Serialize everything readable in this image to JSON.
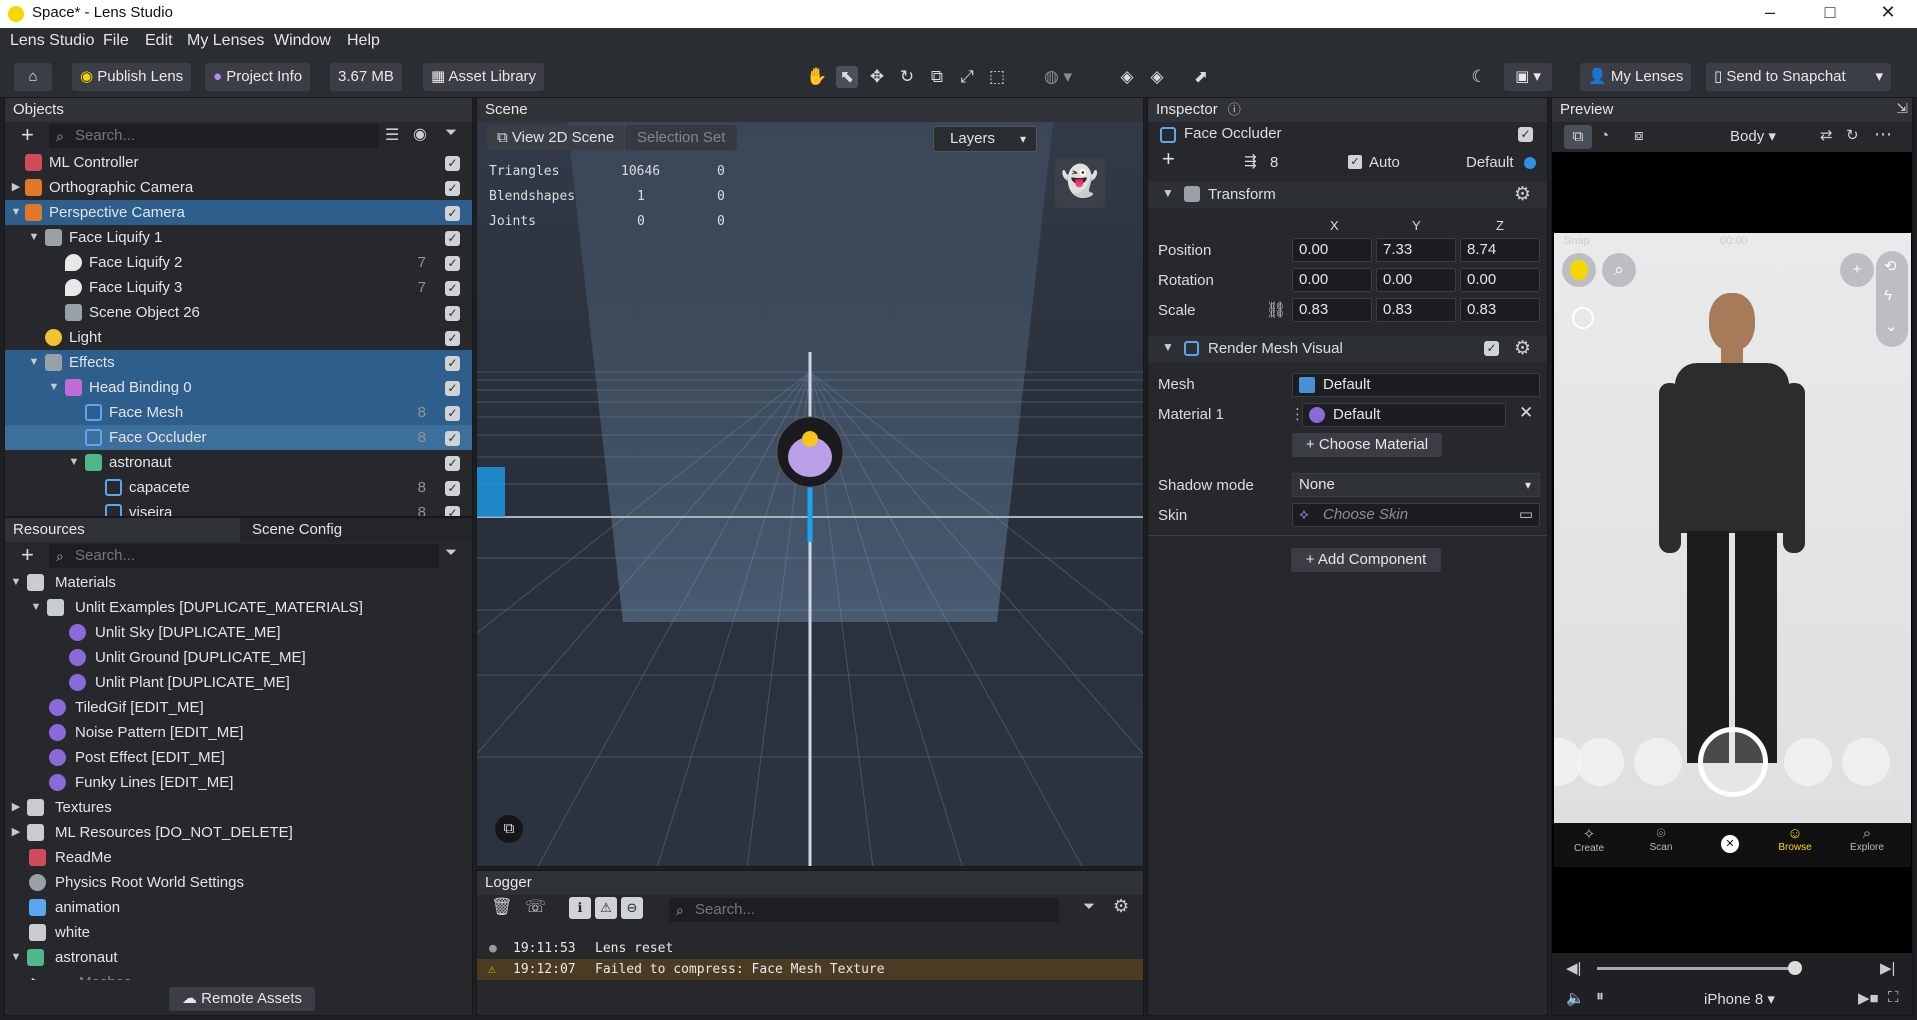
{
  "window": {
    "title": "Space* - Lens Studio",
    "minimize": "–",
    "maximize": "□",
    "close": "✕"
  },
  "menu": [
    "Lens Studio",
    "File",
    "Edit",
    "My Lenses",
    "Window",
    "Help"
  ],
  "toolbar": {
    "publish": "Publish Lens",
    "project_info": "Project Info",
    "size": "3.67 MB",
    "asset_library": "Asset Library",
    "my_lenses": "My Lenses",
    "send_to_snapchat": "Send to Snapchat"
  },
  "objects": {
    "title": "Objects",
    "search_placeholder": "Search...",
    "items": [
      {
        "label": "ML Controller",
        "num": "",
        "sel": false
      },
      {
        "label": "Orthographic Camera",
        "num": "",
        "sel": false
      },
      {
        "label": "Perspective Camera",
        "num": "",
        "sel": true
      },
      {
        "label": "Face Liquify 1",
        "num": "",
        "sel": false
      },
      {
        "label": "Face Liquify 2",
        "num": "7",
        "sel": false
      },
      {
        "label": "Face Liquify 3",
        "num": "7",
        "sel": false
      },
      {
        "label": "Scene Object 26",
        "num": "",
        "sel": false
      },
      {
        "label": "Light",
        "num": "",
        "sel": false
      },
      {
        "label": "Effects",
        "num": "",
        "sel": true
      },
      {
        "label": "Head Binding 0",
        "num": "",
        "sel": true
      },
      {
        "label": "Face Mesh",
        "num": "8",
        "sel": true
      },
      {
        "label": "Face Occluder",
        "num": "8",
        "sel": true
      },
      {
        "label": "astronaut",
        "num": "",
        "sel": false
      },
      {
        "label": "capacete",
        "num": "8",
        "sel": false
      },
      {
        "label": "viseira",
        "num": "8",
        "sel": false
      }
    ]
  },
  "resources": {
    "title": "Resources",
    "tab2": "Scene Config",
    "search_placeholder": "Search...",
    "items": [
      "Materials",
      "Unlit Examples [DUPLICATE_MATERIALS]",
      "Unlit Sky [DUPLICATE_ME]",
      "Unlit Ground [DUPLICATE_ME]",
      "Unlit Plant [DUPLICATE_ME]",
      "TiledGif [EDIT_ME]",
      "Noise Pattern [EDIT_ME]",
      "Post Effect [EDIT_ME]",
      "Funky Lines [EDIT_ME]",
      "Textures",
      "ML Resources [DO_NOT_DELETE]",
      "ReadMe",
      "Physics Root World Settings",
      "animation",
      "white",
      "astronaut",
      "Meshes"
    ],
    "remote_assets": "Remote Assets"
  },
  "scene": {
    "title": "Scene",
    "view2d": "View 2D Scene",
    "selection_set": "Selection Set",
    "layers": "Layers",
    "stats": [
      {
        "name": "Triangles",
        "a": "10646",
        "b": "0"
      },
      {
        "name": "Blendshapes",
        "a": "1",
        "b": "0"
      },
      {
        "name": "Joints",
        "a": "0",
        "b": "0"
      }
    ]
  },
  "logger": {
    "title": "Logger",
    "search_placeholder": "Search...",
    "entries": [
      {
        "time": "19:11:53",
        "msg": "Lens reset",
        "level": "info"
      },
      {
        "time": "19:12:07",
        "msg": "Failed to compress: Face Mesh Texture",
        "level": "warning"
      }
    ]
  },
  "inspector": {
    "title": "Inspector",
    "object_name": "Face Occluder",
    "layer_num": "8",
    "auto": "Auto",
    "default": "Default",
    "transform": {
      "title": "Transform",
      "x": "X",
      "y": "Y",
      "z": "Z",
      "position_label": "Position",
      "position": [
        "0.00",
        "7.33",
        "8.74"
      ],
      "rotation_label": "Rotation",
      "rotation": [
        "0.00",
        "0.00",
        "0.00"
      ],
      "scale_label": "Scale",
      "scale": [
        "0.83",
        "0.83",
        "0.83"
      ]
    },
    "render_mesh": {
      "title": "Render Mesh Visual",
      "mesh_label": "Mesh",
      "mesh": "Default",
      "material_label": "Material 1",
      "material": "Default",
      "choose_material": "Choose Material",
      "shadow_label": "Shadow mode",
      "shadow": "None",
      "skin_label": "Skin",
      "skin_placeholder": "Choose Skin"
    },
    "add_component": "Add Component"
  },
  "preview": {
    "title": "Preview",
    "body_select": "Body",
    "carrier": "Snap",
    "time": "00:00",
    "nav": [
      "Create",
      "Scan",
      "Browse",
      "Explore"
    ],
    "device": "iPhone 8"
  },
  "colors": {
    "selection": "#2e5f8c",
    "accent": "#2d8fe6",
    "snap_yellow": "#f6d800"
  }
}
